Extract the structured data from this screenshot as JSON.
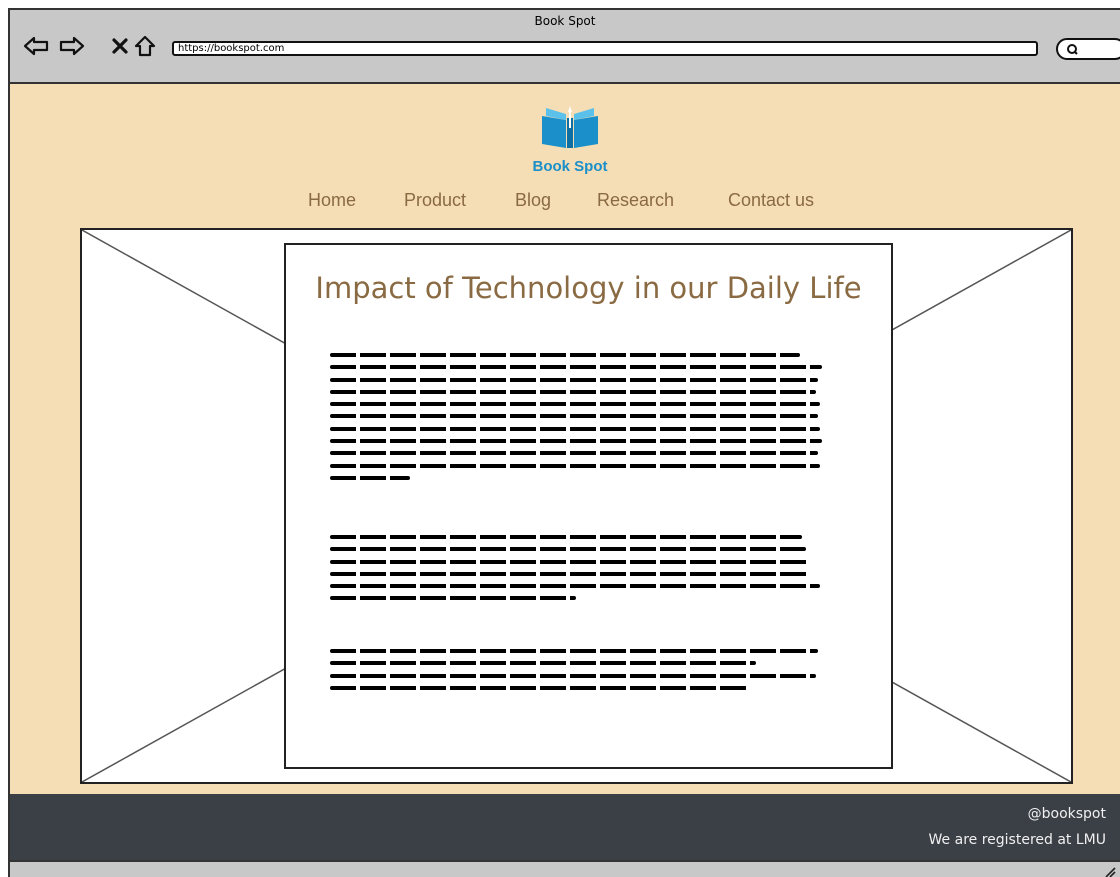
{
  "window": {
    "title": "Book Spot",
    "url": "https://bookspot.com"
  },
  "brand": {
    "name": "Book Spot",
    "color": "#1a8fc9"
  },
  "nav": {
    "items": [
      {
        "label": "Home"
      },
      {
        "label": "Product"
      },
      {
        "label": "Blog"
      },
      {
        "label": "Research"
      },
      {
        "label": "Contact us"
      }
    ]
  },
  "article": {
    "title": "Impact of Technology in our Daily Life",
    "paragraph_lines": [
      11,
      6,
      4
    ]
  },
  "footer": {
    "handle": "@bookspot",
    "note": "We are registered at LMU"
  },
  "colors": {
    "page_bg": "#f5deb5",
    "accent_text": "#8a6a42",
    "footer_bg": "#3b3f46"
  }
}
